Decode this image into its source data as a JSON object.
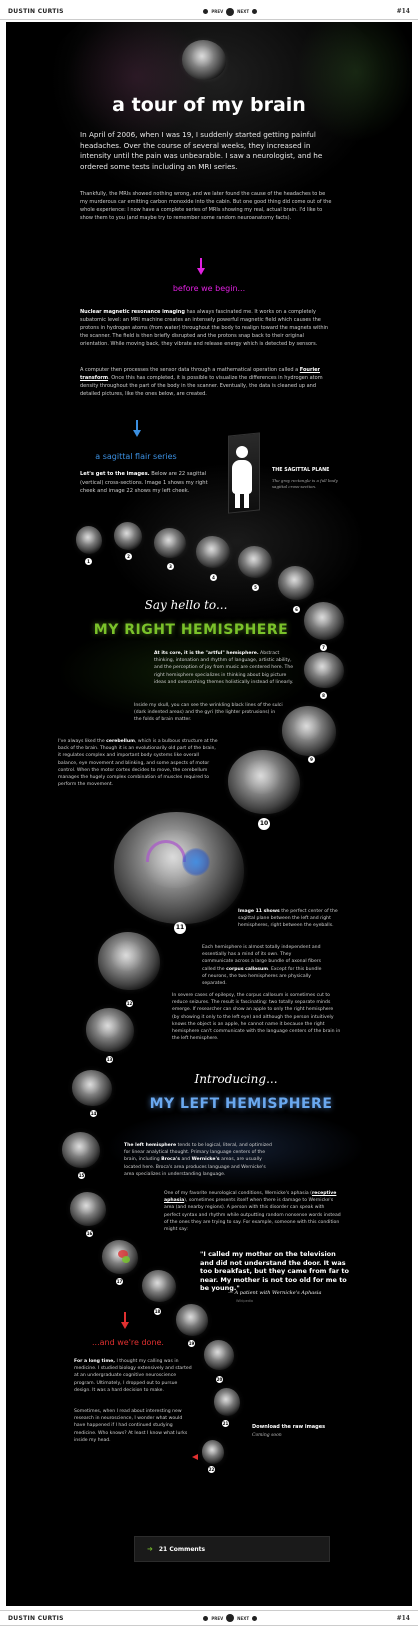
{
  "header": {
    "brand": "DUSTIN CURTIS",
    "prev": "PREV",
    "next": "NEXT",
    "issue": "#14"
  },
  "footer": {
    "brand": "DUSTIN CURTIS",
    "prev": "PREV",
    "next": "NEXT",
    "issue": "#14"
  },
  "intro": {
    "title": "a tour of my brain",
    "lead": "In April of 2006, when I was 19, I suddenly started getting painful headaches. Over the course of several weeks, they increased in intensity until the pain was unbearable. I saw a neurologist, and he ordered some tests including an MRI series.",
    "body": "Thankfully, the MRIs showed nothing wrong, and we later found the cause of the headaches to be my murderous car emitting carbon monoxide into the cabin. But one good thing did come out of the whole experience: I now have a complete series of MRIs showing my real, actual brain. I'd like to show them to you (and maybe try to remember some random neuroanatomy facts)."
  },
  "before": {
    "heading": "before we begin...",
    "p1_strong": "Nuclear magnetic resonance imaging",
    "p1": " has always fascinated me. It works on a completely subatomic level: an MRI machine creates an intensely powerful magnetic field which causes the protons in hydrogen atoms (from water) throughout the body to realign toward the magnets within the scanner. The field is then briefly disrupted and the protons snap back to their original orientation. While moving back, they vibrate and release energy which is detected by sensors.",
    "p2a": "A computer then processes the sensor data through a mathematical operation called a ",
    "p2_link": "Fourier transform",
    "p2b": ". Once this has completed, it is possible to visualize the differences in hydrogen atom density throughout the part of the body in the scanner. Eventually, the data is cleaned up and detailed pictures, like the ones below, are created."
  },
  "sagittal": {
    "heading": "a sagittal flair series",
    "strong": "Let's get to the images.",
    "body": " Below are 22 sagittal (vertical) cross-sections. Image 1 shows my right cheek and image 22 shows my left cheek.",
    "plane_title": "THE SAGITTAL PLANE",
    "plane_caption": "The gray rectangle is a full body sagittal cross-section."
  },
  "right": {
    "script": "Say hello to...",
    "heading": "MY RIGHT HEMISPHERE",
    "p1_strong": "At its core, it is the \"artful\" hemisphere.",
    "p1": " Abstract thinking, intonation and rhythm of language, artistic ability, and the perception of joy from music are centered here. The right hemisphere specializes in thinking about big picture ideas and overarching themes holistically instead of linearly.",
    "p2": "Inside my skull, you can see the wrinkling black lines of the sulci (dark indented areas) and the gyri (the lighter protrusions) in the folds of brain matter.",
    "p3a": "I've always liked the ",
    "p3_link": "cerebellum",
    "p3b": ", which is a bulbous structure at the back of the brain. Though it is an evolutionarily old part of the brain, it regulates complex and important body systems like overall balance, eye movement and blinking, and some aspects of motor control. When the motor cortex decides to move, the cerebellum manages the hugely complex combination of muscles required to perform the movement."
  },
  "middle": {
    "p1_strong": "Image 11 shows",
    "p1": " the perfect center of the sagittal plane between the left and right hemispheres, right between the eyeballs.",
    "p2a": "Each hemisphere is almost totally independent and essentially has a mind of its own. They communicate across a large bundle of axonal fibers called the ",
    "p2_link": "corpus callosum",
    "p2b": ". Except for this bundle of neurons, the two hemispheres are physically separated.",
    "p3": "In severe cases of epilepsy, the corpus callosum is sometimes cut to reduce seizures. The result is fascinating: two totally separate minds emerge. If researcher can show an apple to only the right hemisphere (by showing it only to the left eye) and although the person intuitively knows the object is an apple, he cannot name it because the right hemisphere can't communicate with the language centers of the brain in the left hemisphere."
  },
  "left": {
    "script": "Introducing...",
    "heading": "MY LEFT HEMISPHERE",
    "p1_strong": "The left hemisphere",
    "p1a": " tends to be logical, literal, and optimized for linear analytical thought. Primary language centers of the brain, including ",
    "broca": "Broca's",
    "and": " and ",
    "wernicke": "Wernicke's",
    "p1b": " areas, are usually located here. Broca's area produces language and Wernicke's area specializes in understanding language.",
    "p2a": "One of my favorite neurological conditions, Wernicke's aphasia (",
    "p2_link": "receptive aphasia",
    "p2b": "), sometimes presents itself when there is damage to Wernicke's area (and nearby regions). A person with this disorder can speak with perfect syntax and rhythm while outputting random nonsense words instead of the ones they are trying to say. For example, someone with this condition might say:",
    "quote": "\"I called my mother on the television and did not understand the door. It was too breakfast, but they came from far to near. My mother is not too old for me to be young.\"",
    "cite": "— A patient with Wernicke's Aphasia",
    "cite_sub": "Wikipedia"
  },
  "done": {
    "heading": "...and we're done.",
    "p1_strong": "For a long time,",
    "p1": " I thought my calling was in medicine. I studied biology extensively and started at an undergraduate cognitive neuroscience program. Ultimately, I dropped out to pursue design. It was a hard decision to make.",
    "p2": "Sometimes, when I read about interesting new research in neuroscience, I wonder what would have happened if I had continued studying medicine. Who knows? At least I know what lurks inside my head.",
    "download_title": "Download the raw images",
    "download_sub": "Coming soon"
  },
  "comments": {
    "label": "21 Comments",
    "icon": "comment-icon"
  },
  "numbers": [
    "1",
    "2",
    "3",
    "4",
    "5",
    "6",
    "7",
    "8",
    "9",
    "10",
    "11",
    "12",
    "13",
    "14",
    "15",
    "16",
    "17",
    "18",
    "19",
    "20",
    "21",
    "22"
  ],
  "colors": {
    "page_bg": "#000000",
    "title_white": "#ffffff",
    "magenta": "#e020e0",
    "blue": "#3b8fe0",
    "green": "#7ac22a",
    "left_blue": "#6aa8ef",
    "red": "#e03030"
  }
}
